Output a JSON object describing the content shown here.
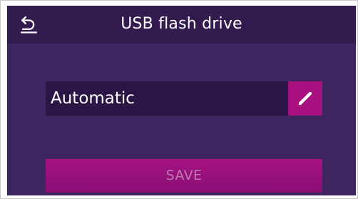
{
  "header": {
    "title": "USB flash drive",
    "back_icon": "back-arrow-icon"
  },
  "field": {
    "value": "Automatic",
    "edit_icon": "pencil-icon"
  },
  "actions": {
    "save_label": "SAVE",
    "save_enabled": false
  },
  "colors": {
    "background": "#3f2560",
    "header": "#331b4f",
    "field": "#2b1446",
    "accent": "#a6117f",
    "disabled_text": "#c07bb0"
  }
}
